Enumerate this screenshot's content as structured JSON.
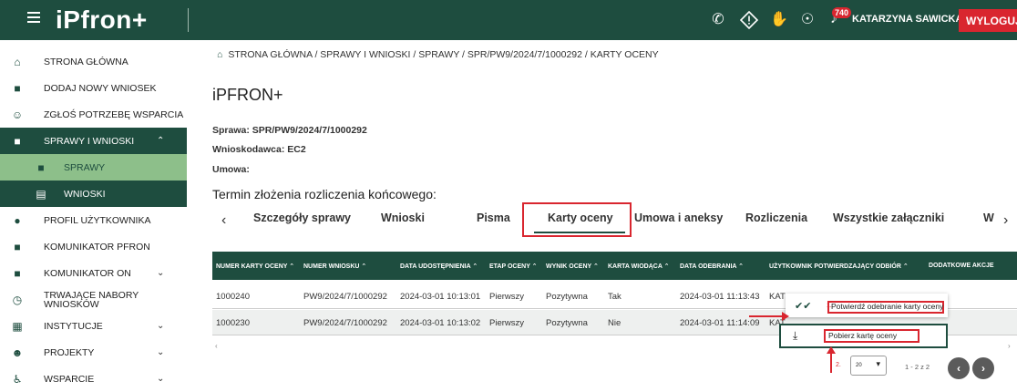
{
  "app": {
    "logo": "iPfron+"
  },
  "topbar": {
    "icons": [
      "phone-icon",
      "warning-diamond-icon",
      "sign-language-icon",
      "hearing-icon"
    ],
    "notification_count": "740",
    "user": "KATARZYNA SAWICKA",
    "logout_label": "WYLOGUJ"
  },
  "sidebar": {
    "items": [
      {
        "label": "STRONA GŁÓWNA",
        "icon": "home-icon"
      },
      {
        "label": "DODAJ NOWY WNIOSEK",
        "icon": "document-add-icon"
      },
      {
        "label": "ZGŁOŚ POTRZEBĘ WSPARCIA",
        "icon": "person-voice-icon"
      },
      {
        "label": "SPRAWY I WNIOSKI",
        "icon": "briefcase-icon"
      },
      {
        "label": "SPRAWY",
        "icon": "briefcase-icon"
      },
      {
        "label": "WNIOSKI",
        "icon": "document-icon"
      },
      {
        "label": "PROFIL UŻYTKOWNIKA",
        "icon": "user-icon"
      },
      {
        "label": "KOMUNIKATOR PFRON",
        "icon": "chat-icon"
      },
      {
        "label": "KOMUNIKATOR ON",
        "icon": "chat-icon"
      },
      {
        "label": "TRWAJĄCE NABORY WNIOSKÓW",
        "icon": "clock-icon"
      },
      {
        "label": "INSTYTUCJE",
        "icon": "building-icon"
      },
      {
        "label": "PROJEKTY",
        "icon": "people-icon"
      },
      {
        "label": "WSPARCIE",
        "icon": "accessibility-icon"
      }
    ]
  },
  "breadcrumb": "STRONA GŁÓWNA / SPRAWY I WNIOSKI / SPRAWY / SPR/PW9/2024/7/1000292 / KARTY OCENY",
  "page": {
    "title": "iPFRON+",
    "sprawa": "Sprawa: SPR/PW9/2024/7/1000292",
    "wnioskodawca": "Wnioskodawca: EC2",
    "umowa": "Umowa:",
    "termin": "Termin złożenia rozliczenia końcowego:"
  },
  "tabs": [
    "Szczegóły sprawy",
    "Wnioski",
    "Pisma",
    "Karty oceny",
    "Umowa i aneksy",
    "Rozliczenia",
    "Wszystkie załączniki",
    "W"
  ],
  "table": {
    "headers": [
      "NUMER KARTY OCENY ⌃",
      "NUMER WNIOSKU ⌃",
      "DATA UDOSTĘPNIENIA ⌃",
      "ETAP OCENY ⌃",
      "WYNIK OCENY ⌃",
      "KARTA WIODĄCA ⌃",
      "DATA ODEBRANIA ⌃",
      "UŻYTKOWNIK POTWIERDZAJĄCY ODBIÓR ⌃",
      "DODATKOWE AKCJE"
    ],
    "rows": [
      [
        "1000240",
        "PW9/2024/7/1000292",
        "2024-03-01 10:13:01",
        "Pierwszy",
        "Pozytywna",
        "Tak",
        "2024-03-01 11:13:43",
        "KAT"
      ],
      [
        "1000230",
        "PW9/2024/7/1000292",
        "2024-03-01 10:13:02",
        "Pierwszy",
        "Pozytywna",
        "Nie",
        "2024-03-01 11:14:09",
        "KAT"
      ]
    ]
  },
  "context_menu": {
    "confirm": "Potwierdź odebranie karty oceny",
    "download": "Pobierz kartę oceny",
    "step1": "1.",
    "step2": "2."
  },
  "pager": {
    "page_size": "20",
    "info": "1 - 2 z 2"
  }
}
